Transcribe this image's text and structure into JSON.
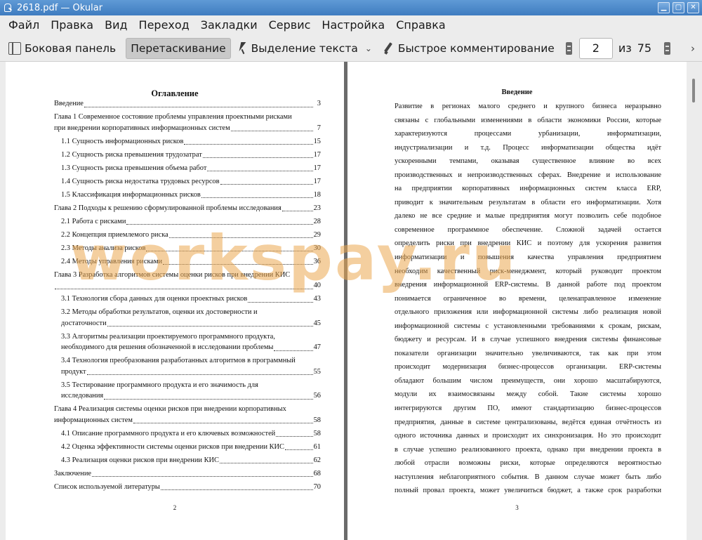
{
  "window": {
    "title": "2618.pdf  — Okular"
  },
  "menu": [
    "Файл",
    "Правка",
    "Вид",
    "Переход",
    "Закладки",
    "Сервис",
    "Настройка",
    "Справка"
  ],
  "toolbar": {
    "sidebar": "Боковая панель",
    "drag": "Перетаскивание",
    "select_text": "Выделение текста",
    "quick_annotate": "Быстрое комментирование",
    "page_current": "2",
    "page_of": "из",
    "page_total": "75"
  },
  "left_page": {
    "title": "Оглавление",
    "page_number": "2",
    "toc": [
      {
        "text": "Введение",
        "page": "3",
        "sub": false
      },
      {
        "line1": "Глава 1 Современное состояние проблемы управления проектными рисками",
        "text": "при внедрении корпоративных информационных систем",
        "page": "7",
        "sub": false
      },
      {
        "text": "1.1 Сущность информационных рисков",
        "page": "15",
        "sub": true
      },
      {
        "text": "1.2 Сущность риска превышения трудозатрат",
        "page": "17",
        "sub": true
      },
      {
        "text": "1.3 Сущность риска превышения объема работ",
        "page": "17",
        "sub": true
      },
      {
        "text": "1.4 Сущность риска недостатка трудовых ресурсов",
        "page": "17",
        "sub": true
      },
      {
        "text": "1.5 Классификация информационных рисков",
        "page": "18",
        "sub": true
      },
      {
        "text": "Глава 2 Подходы к решению сформулированной проблемы исследования",
        "page": "23",
        "sub": false
      },
      {
        "text": "2.1 Работа с рисками",
        "page": "28",
        "sub": true
      },
      {
        "text": "2.2 Концепция приемлемого риска",
        "page": "29",
        "sub": true
      },
      {
        "text": "2.3 Методы анализа рисков",
        "page": "30",
        "sub": true
      },
      {
        "text": "2.4 Методы управления рисками",
        "page": "36",
        "sub": true
      },
      {
        "line1": "Глава 3 Разработка алгоритмов системы оценки рисков при внедрении КИС",
        "text": "",
        "page": "40",
        "sub": false
      },
      {
        "text": "3.1 Технология сбора данных для оценки проектных рисков",
        "page": "43",
        "sub": true
      },
      {
        "line1": "3.2     Методы обработки результатов, оценки их достоверности и",
        "text": "достаточности",
        "page": "45",
        "sub": true
      },
      {
        "line1": "3.3 Алгоритмы реализации проектируемого программного продукта,",
        "text": "необходимого для решения обозначенной в исследовании проблемы",
        "page": "47",
        "sub": true
      },
      {
        "line1": "3.4 Технология преобразования разработанных алгоритмов в программный",
        "text": "продукт",
        "page": "55",
        "sub": true
      },
      {
        "line1": "3.5 Тестирование программного продукта и его значимость для",
        "text": "исследования",
        "page": "56",
        "sub": true
      },
      {
        "line1": "Глава 4 Реализация системы оценки рисков при внедрении корпоративных",
        "text": "информационных систем",
        "page": "58",
        "sub": false
      },
      {
        "text": "4.1 Описание программного продукта и его ключевых возможностей",
        "page": "58",
        "sub": true
      },
      {
        "text": "4.2 Оценка эффективности системы оценки рисков при внедрении КИС",
        "page": "61",
        "sub": true
      },
      {
        "text": "4.3 Реализация оценки рисков при внедрении КИС",
        "page": "62",
        "sub": true
      },
      {
        "text": "Заключение",
        "page": "68",
        "sub": false
      },
      {
        "text": "Список используемой литературы",
        "page": "70",
        "sub": false
      }
    ]
  },
  "right_page": {
    "title": "Введение",
    "page_number": "3",
    "lines": [
      "      Развитие в регионах малого среднего и крупного бизнеса неразрывно",
      "связаны с глобальными изменениями в области экономики России, которые",
      "характеризуются процессами урбанизации, информатизации,",
      "индустриализации и т.д. Процесс информатизации общества идёт",
      "ускоренными темпами, оказывая существенное влияние во всех",
      "производственных и непроизводственных сферах. Внедрение и использование",
      "на предприятии корпоративных информационных систем класса ERP,",
      "приводит к значительным результатам в области его информатизации. Хотя",
      "далеко не все средние и малые предприятия могут позволить себе подобное",
      "современное программное обеспечение. Сложной задачей остается",
      "определить риски при внедрении КИС и поэтому для ускорения развития",
      "информатизации и повышения качества управления предприятием",
      "необходим качественный риск-менеджмент, который руководит проектом",
      "внедрения информационной ERP-системы. В данной работе под проектом",
      "понимается ограниченное во времени, целенаправленное изменение",
      "отдельного приложения или информационной системы либо реализация новой",
      "информационной системы с установленными требованиями к срокам, рискам,",
      "бюджету и ресурсам. И в случае успешного внедрения системы финансовые",
      "показатели организации значительно увеличиваются, так как при этом",
      "происходит модернизация бизнес-процессов организации. ERP-системы",
      "обладают большим числом преимуществ, они хорошо масштабируются,",
      "модули их взаимосвязаны между собой. Такие системы хорошо",
      "интегрируются другим ПО, имеют стандартизацию бизнес-процессов",
      "предприятия, данные в системе централизованы, ведётся единая отчётность из",
      "одного источника данных и происходит их синхронизация. Но это происходит",
      "в случае успешно реализованного проекта, однако при внедрении проекта в",
      "любой отрасли возможны риски, которые определяются вероятностью",
      "наступления неблагоприятного события. В данном случае может быть либо",
      "полный провал проекта, может увеличиться бюджет, а также срок разработки"
    ]
  },
  "watermark": "workspay.ru"
}
